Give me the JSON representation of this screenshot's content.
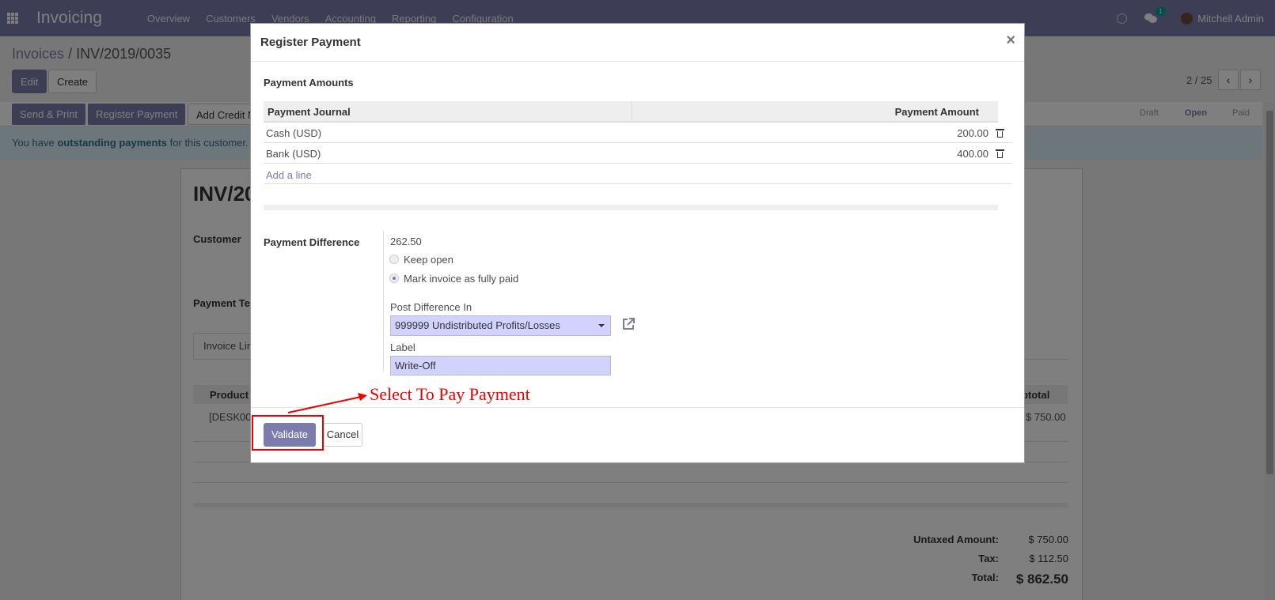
{
  "navbar": {
    "brand": "Invoicing",
    "menu": [
      "Overview",
      "Customers",
      "Vendors",
      "Accounting",
      "Reporting",
      "Configuration"
    ],
    "chat_badge": "1",
    "user": "Mitchell Admin"
  },
  "page": {
    "breadcrumb_parent": "Invoices",
    "breadcrumb_sep": "/",
    "breadcrumb_current": "INV/2019/0035",
    "edit_label": "Edit",
    "create_label": "Create",
    "pager": "2 / 25",
    "status_buttons": [
      "Send & Print",
      "Register Payment",
      "Add Credit N"
    ],
    "stages": [
      "Draft",
      "Open",
      "Paid"
    ],
    "alert_prefix": "You have ",
    "alert_bold": "outstanding payments",
    "alert_suffix": " for this customer.",
    "sheet_title": "INV/20",
    "customer_label": "Customer",
    "payment_terms_label": "Payment Te",
    "tab_label": "Invoice Lin",
    "col_product": "Product",
    "col_subtotal": "ubtotal",
    "row_product": "[DESK00",
    "row_subtotal": "$ 750.00",
    "untaxed_label": "Untaxed Amount:",
    "untaxed_value": "$ 750.00",
    "tax_label": "Tax:",
    "tax_value": "$ 112.50",
    "total_label": "Total:",
    "total_value": "$ 862.50"
  },
  "modal": {
    "title": "Register Payment",
    "close": "×",
    "section_title": "Payment Amounts",
    "col_journal": "Payment Journal",
    "col_amount": "Payment Amount",
    "rows": [
      {
        "journal": "Cash (USD)",
        "amount": "200.00"
      },
      {
        "journal": "Bank (USD)",
        "amount": "400.00"
      }
    ],
    "add_line": "Add a line",
    "difference_label": "Payment Difference",
    "difference_value": "262.50",
    "option_keep_open": "Keep open",
    "option_fully_paid": "Mark invoice as fully paid",
    "post_diff_label": "Post Difference In",
    "post_diff_value": "999999 Undistributed Profits/Losses",
    "label_label": "Label",
    "label_value": "Write-Off",
    "validate": "Validate",
    "cancel": "Cancel"
  },
  "annotation": {
    "text": "Select To Pay Payment"
  },
  "colors": {
    "brand": "#7c7bad",
    "annotation": "#ee0000",
    "field_bg": "#d2d2ff"
  }
}
